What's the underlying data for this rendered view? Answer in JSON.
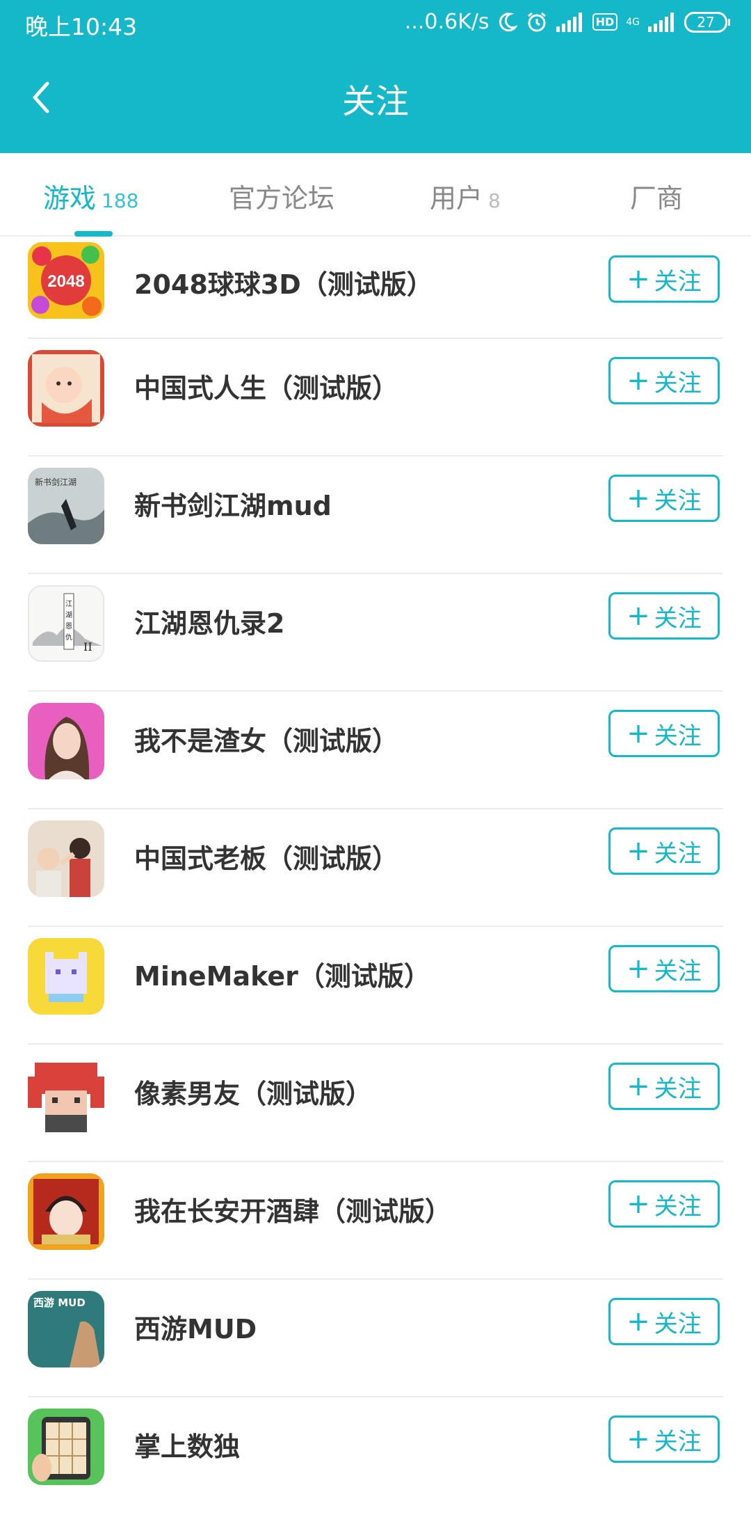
{
  "status_bar": {
    "time": "晚上10:43",
    "network_speed": "...0.6K/s",
    "hd": "HD",
    "lte": "4G",
    "battery": "27"
  },
  "header": {
    "title": "关注",
    "back_icon": "chevron-left-icon"
  },
  "tabs": [
    {
      "label": "游戏",
      "count": "188",
      "active": true
    },
    {
      "label": "官方论坛",
      "count": ""
    },
    {
      "label": "用户",
      "count": "8"
    },
    {
      "label": "厂商",
      "count": ""
    }
  ],
  "follow_label": "关注",
  "games": [
    {
      "title": "2048球球3D（测试版）",
      "icon": "2048-balls-icon"
    },
    {
      "title": "中国式人生（测试版）",
      "icon": "baby-icon"
    },
    {
      "title": "新书剑江湖mud",
      "icon": "ink-painting-icon"
    },
    {
      "title": "江湖恩仇录2",
      "icon": "ink-landscape-icon"
    },
    {
      "title": "我不是渣女（测试版）",
      "icon": "woman-portrait-icon"
    },
    {
      "title": "中国式老板（测试版）",
      "icon": "office-boss-icon"
    },
    {
      "title": "MineMaker（测试版）",
      "icon": "pixel-cat-icon"
    },
    {
      "title": "像素男友（测试版）",
      "icon": "pixel-boy-icon"
    },
    {
      "title": "我在长安开酒肆（测试版）",
      "icon": "tavern-girl-icon"
    },
    {
      "title": "西游MUD",
      "icon": "journey-west-icon",
      "icon_text": "西游 MUD"
    },
    {
      "title": "掌上数独",
      "icon": "sudoku-icon"
    }
  ],
  "colors": {
    "accent": "#14b8c8",
    "text": "#333333",
    "inactive_tab": "#888888"
  }
}
